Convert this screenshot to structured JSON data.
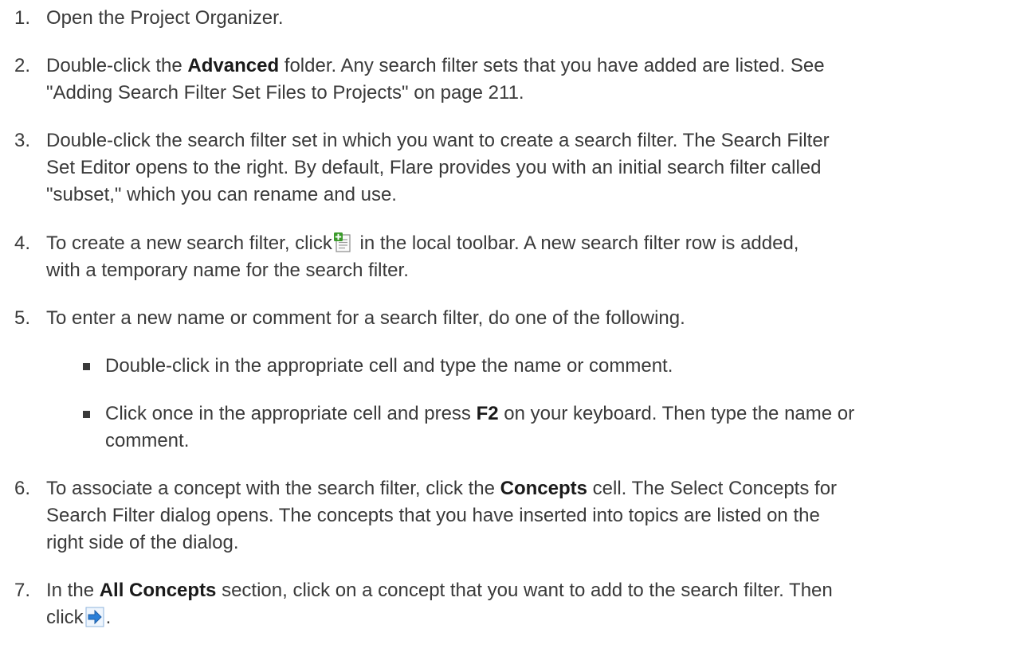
{
  "steps": [
    {
      "num": "1.",
      "text": "Open the Project Organizer."
    },
    {
      "num": "2.",
      "pre": "Double-click the ",
      "bold": "Advanced",
      "post": " folder. Any search filter sets that you have added are listed. See",
      "line2": "\"Adding Search Filter Set Files to Projects\" on page 211."
    },
    {
      "num": "3.",
      "line1": "Double-click the search filter set in which you want to create a search filter. The Search Filter",
      "line2": "Set Editor opens to the right. By default, Flare provides you with an initial search filter called",
      "line3": "\"subset,\" which you can rename and use."
    },
    {
      "num": "4.",
      "pre": "To create a new search filter, click",
      "post": " in the local toolbar. A new search filter row is added,",
      "line2": "with a temporary name for the search filter.",
      "icon": "new-item-icon"
    },
    {
      "num": "5.",
      "text": "To enter a new name or comment for a search filter, do one of the following."
    },
    {
      "num": "6.",
      "pre": "To associate a concept with the search filter, click the ",
      "bold": "Concepts",
      "post": " cell. The Select Concepts for",
      "line2": "Search Filter dialog opens. The concepts that you have inserted into topics are listed on the",
      "line3": "right side of the dialog."
    },
    {
      "num": "7.",
      "pre": "In the ",
      "bold": "All Concepts",
      "post": " section, click on a concept that you want to add to the search filter. Then",
      "line2_pre": "click",
      "line2_post": ".",
      "icon": "right-arrow-icon"
    }
  ],
  "substeps": [
    {
      "text": "Double-click in the appropriate cell and type the name or comment."
    },
    {
      "pre": "Click once in the appropriate cell and press ",
      "bold": "F2",
      "post": " on your keyboard. Then type the name or",
      "line2": "comment."
    }
  ],
  "colors": {
    "text": "#3a3a3a",
    "icon_green": "#3a9a2a",
    "icon_blue": "#2a7fd8"
  }
}
